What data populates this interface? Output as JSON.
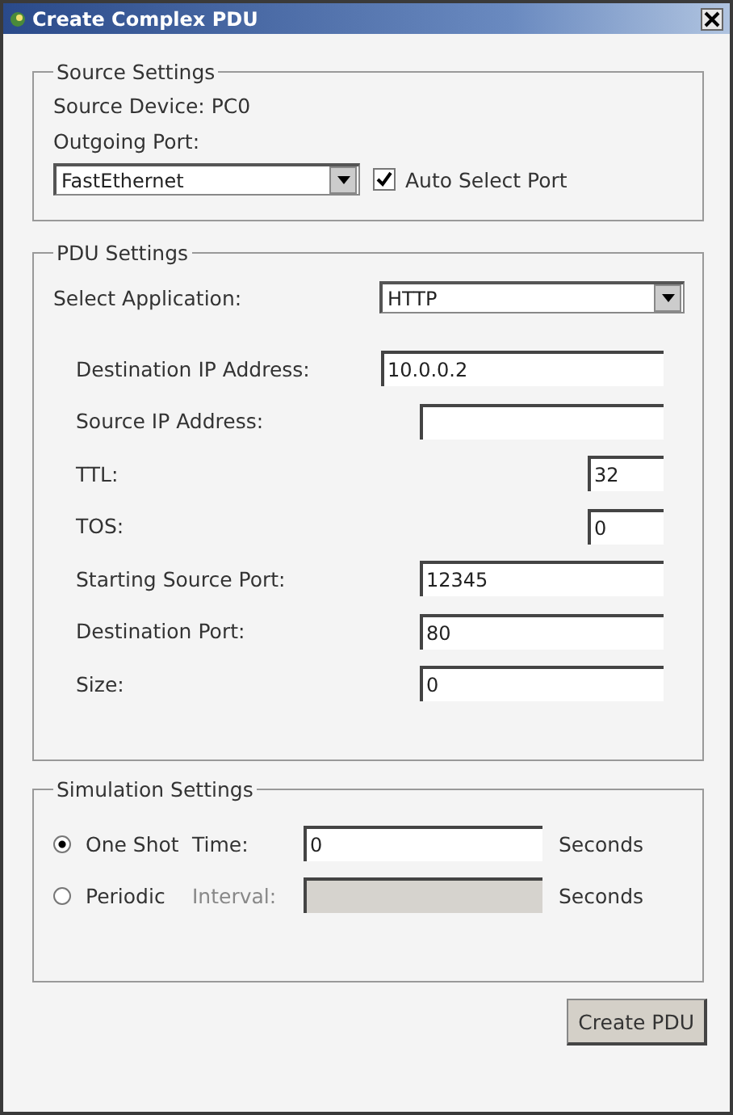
{
  "window": {
    "title": "Create Complex PDU"
  },
  "source_settings": {
    "title": "Source Settings",
    "device": "Source Device: PC0",
    "port_label": "Outgoing Port:",
    "port": "FastEthernet",
    "auto_select": {
      "label": "Auto Select Port",
      "checked": true
    }
  },
  "pdu_settings": {
    "title": "PDU Settings",
    "app_label": "Select Application:",
    "app": "HTTP",
    "fields": [
      {
        "label": "Destination IP Address:",
        "value": "10.0.0.2",
        "kind": "wide"
      },
      {
        "label": "Source IP Address:",
        "kind": "medium"
      },
      {
        "label": "TTL:",
        "value": "32",
        "kind": "narrow"
      },
      {
        "label": "TOS:",
        "value": "0",
        "kind": "narrow"
      },
      {
        "label": "Starting Source Port:",
        "value": "12345",
        "kind": "medium"
      },
      {
        "label": "Destination Port:",
        "value": "80",
        "kind": "medium"
      },
      {
        "label": "Size:",
        "value": "0",
        "kind": "medium"
      }
    ]
  },
  "simulation_settings": {
    "title": "Simulation Settings",
    "modes": [
      {
        "label": "One Shot",
        "selected": true,
        "field_label": "Time:",
        "value": "0",
        "disabled": false,
        "unit": "Seconds"
      },
      {
        "label": "Periodic",
        "selected": false,
        "field_label": "Interval:",
        "disabled": true,
        "unit": "Seconds"
      }
    ]
  },
  "buttons": [
    "Create PDU"
  ]
}
